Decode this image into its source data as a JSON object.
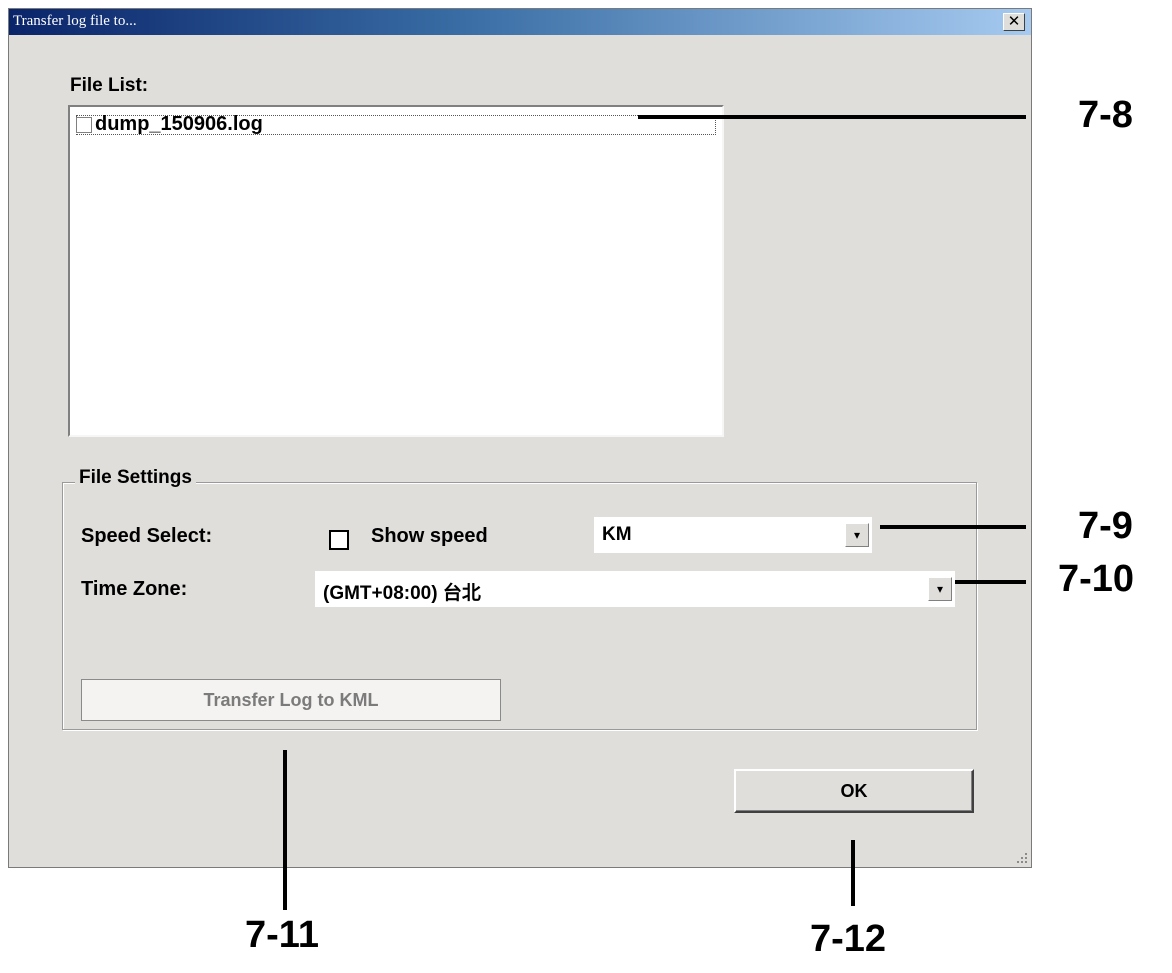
{
  "window": {
    "title": "Transfer log file to...",
    "close_glyph": "✕"
  },
  "file_list": {
    "label": "File List:",
    "items": [
      {
        "name": "dump_150906.log",
        "checked": false
      }
    ]
  },
  "settings": {
    "legend": "File Settings",
    "speed_label": "Speed Select:",
    "show_speed_label": "Show speed",
    "show_speed_checked": false,
    "speed_unit": "KM",
    "time_zone_label": "Time Zone:",
    "time_zone_value": "(GMT+08:00) 台北",
    "transfer_button": "Transfer Log to KML"
  },
  "ok_button": "OK",
  "callouts": {
    "file_list": "7-8",
    "speed": "7-9",
    "time_zone": "7-10",
    "transfer": "7-11",
    "ok": "7-12"
  },
  "icons": {
    "dropdown": "chevron-down-icon",
    "close": "close-icon",
    "resize": "resize-grip-icon"
  },
  "colors": {
    "dialog_bg": "#e0dedb",
    "title_start": "#0a246a",
    "title_end": "#a6caf0"
  }
}
